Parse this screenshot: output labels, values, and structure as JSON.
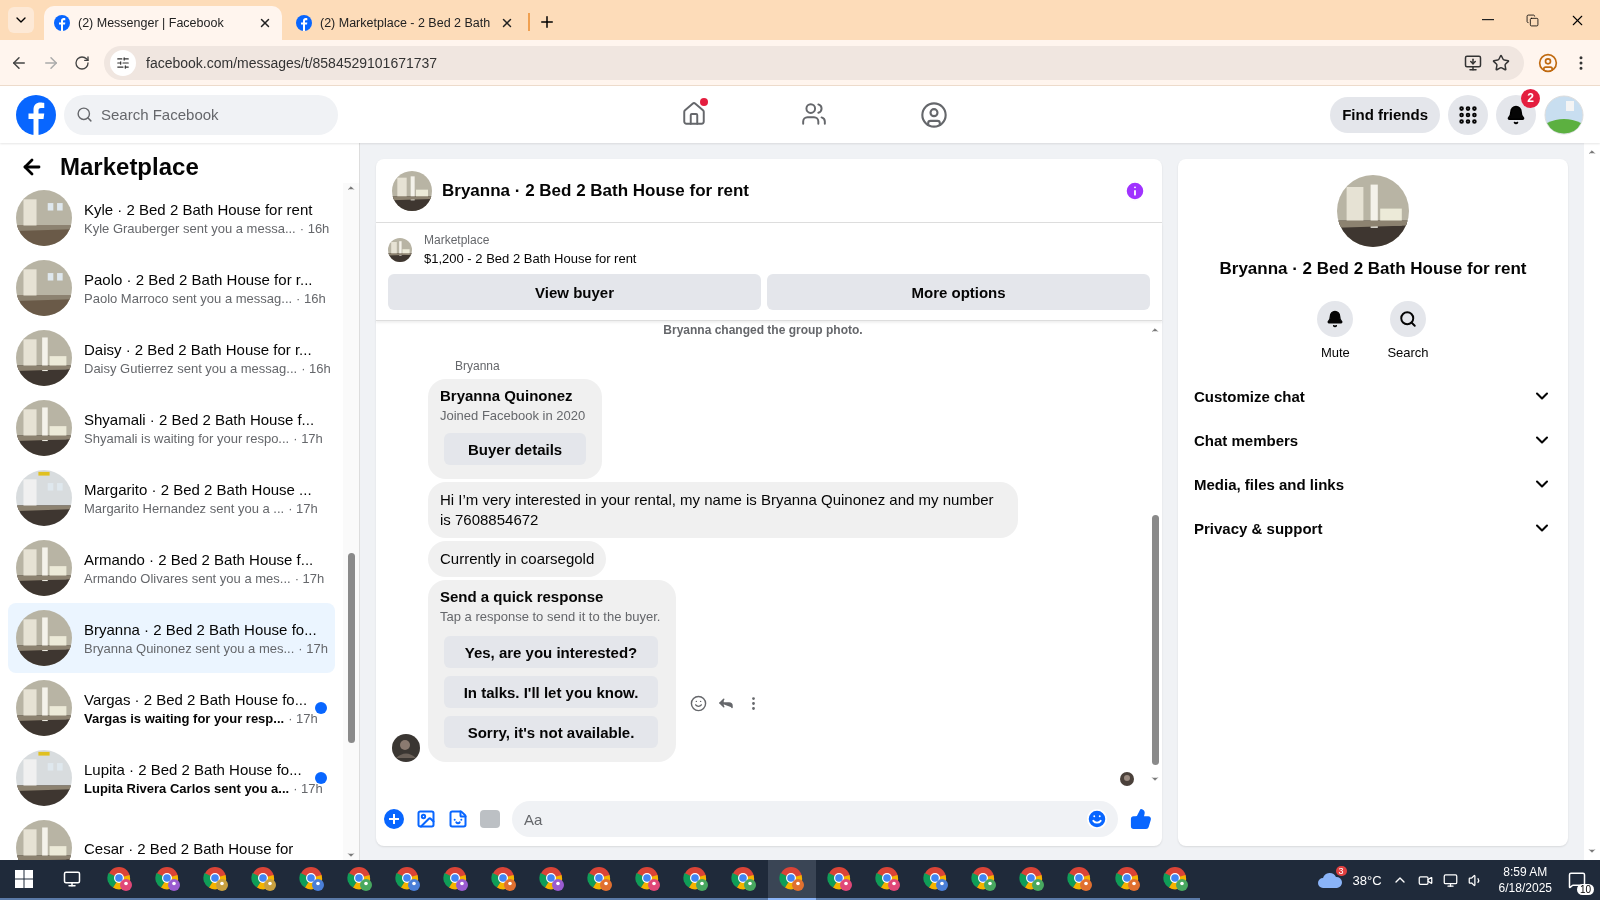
{
  "browser": {
    "tabs": [
      {
        "title": "(2) Messenger | Facebook",
        "selected": true
      },
      {
        "title": "(2) Marketplace - 2 Bed 2 Bath",
        "selected": false
      }
    ],
    "url": "facebook.com/messages/t/8584529101671737"
  },
  "header": {
    "search": {
      "placeholder": "Search Facebook"
    },
    "nav": [
      {
        "kind": "home",
        "dot": true
      },
      {
        "kind": "friends",
        "dot": false
      },
      {
        "kind": "groups",
        "dot": false
      }
    ],
    "find_friends": "Find friends",
    "notification_count": "2"
  },
  "sidebar": {
    "title": "Marketplace",
    "conversations": [
      {
        "title": "Kyle · 2 Bed 2 Bath House for rent",
        "preview": "Kyle Grauberger sent you a messa...",
        "time": "· 16h",
        "selected": false,
        "unread": false
      },
      {
        "title": "Paolo · 2 Bed 2 Bath House for r...",
        "preview": "Paolo Marroco sent you a messag...",
        "time": "· 16h",
        "selected": false,
        "unread": false
      },
      {
        "title": "Daisy · 2 Bed 2 Bath House for r...",
        "preview": "Daisy Gutierrez sent you a messag...",
        "time": "· 16h",
        "selected": false,
        "unread": false
      },
      {
        "title": "Shyamali · 2 Bed 2 Bath House f...",
        "preview": "Shyamali is waiting for your respo...",
        "time": "· 17h",
        "selected": false,
        "unread": false
      },
      {
        "title": "Margarito · 2 Bed 2 Bath House ...",
        "preview": "Margarito Hernandez sent you a ...",
        "time": "· 17h",
        "selected": false,
        "unread": false
      },
      {
        "title": "Armando · 2 Bed 2 Bath House f...",
        "preview": "Armando Olivares sent you a mes...",
        "time": "· 17h",
        "selected": false,
        "unread": false
      },
      {
        "title": "Bryanna · 2 Bed 2 Bath House fo...",
        "preview": "Bryanna Quinonez sent you a mes...",
        "time": "· 17h",
        "selected": true,
        "unread": false
      },
      {
        "title": "Vargas · 2 Bed 2 Bath House fo...",
        "preview": "Vargas is waiting for your resp...",
        "time": "· 17h",
        "selected": false,
        "unread": true
      },
      {
        "title": "Lupita · 2 Bed 2 Bath House fo...",
        "preview": "Lupita Rivera Carlos sent you a...",
        "time": "· 17h",
        "selected": false,
        "unread": true
      },
      {
        "title": "Cesar · 2 Bed 2 Bath House for",
        "selected": false,
        "unread": false
      }
    ]
  },
  "chat": {
    "title": "Bryanna · 2 Bed 2 Bath House for rent",
    "listing": {
      "label": "Marketplace",
      "title": "$1,200 - 2 Bed 2 Bath House for rent"
    },
    "buttons": [
      "View buyer",
      "More options"
    ],
    "system_note": "Bryanna changed the group photo.",
    "sender": "Bryanna",
    "card": {
      "name": "Bryanna Quinonez",
      "joined": "Joined Facebook in 2020",
      "button": "Buyer details"
    },
    "messages": [
      "Hi I’m very interested in your rental, my name is Bryanna Quinonez and my number is 7608854672",
      "Currently in coarsegold"
    ],
    "quick_response": {
      "title": "Send a quick response",
      "subtitle": "Tap a response to send it to the buyer.",
      "options": [
        "Yes, are you interested?",
        "In talks. I'll let you know.",
        "Sorry, it's not available."
      ]
    },
    "composer": {
      "placeholder": "Aa"
    }
  },
  "details": {
    "title": "Bryanna · 2 Bed 2 Bath House for rent",
    "actions": [
      {
        "kind": "mute",
        "label": "Mute"
      },
      {
        "kind": "search",
        "label": "Search"
      }
    ],
    "sections": [
      {
        "label": "Customize chat",
        "expanded": false
      },
      {
        "label": "Chat members",
        "expanded": false
      },
      {
        "label": "Media, files and links",
        "expanded": false
      },
      {
        "label": "Privacy & support",
        "expanded": false
      }
    ]
  },
  "taskbar": {
    "apps": [
      {
        "color": "#e04878",
        "selected": false
      },
      {
        "color": "#9a5cd0",
        "selected": false
      },
      {
        "color": "#c8a040",
        "selected": false
      },
      {
        "color": "#c8a040",
        "selected": false
      },
      {
        "color": "#4a7fd8",
        "selected": false
      },
      {
        "color": "#48a860",
        "selected": false
      },
      {
        "color": "#4a7fd8",
        "selected": false
      },
      {
        "color": "#9a5cd0",
        "selected": false
      },
      {
        "color": "#e07030",
        "selected": false
      },
      {
        "color": "#9a5cd0",
        "selected": false
      },
      {
        "color": "#e07030",
        "selected": false
      },
      {
        "color": "#e04878",
        "selected": false
      },
      {
        "color": "#48a860",
        "selected": false
      },
      {
        "color": "#48a860",
        "selected": false
      },
      {
        "color": "#e07030",
        "selected": true
      },
      {
        "color": "#e04878",
        "selected": false
      },
      {
        "color": "#e04878",
        "selected": false
      },
      {
        "color": "#4a7fd8",
        "selected": false
      },
      {
        "color": "#48a860",
        "selected": false
      },
      {
        "color": "#48a860",
        "selected": false
      },
      {
        "color": "#e07030",
        "selected": false
      },
      {
        "color": "#e07030",
        "selected": false
      },
      {
        "color": "#48a860",
        "selected": false
      }
    ],
    "weather_badge": "3",
    "temperature": "38°C",
    "time": "8:59 AM",
    "date": "6/18/2025",
    "notifications": "10"
  }
}
